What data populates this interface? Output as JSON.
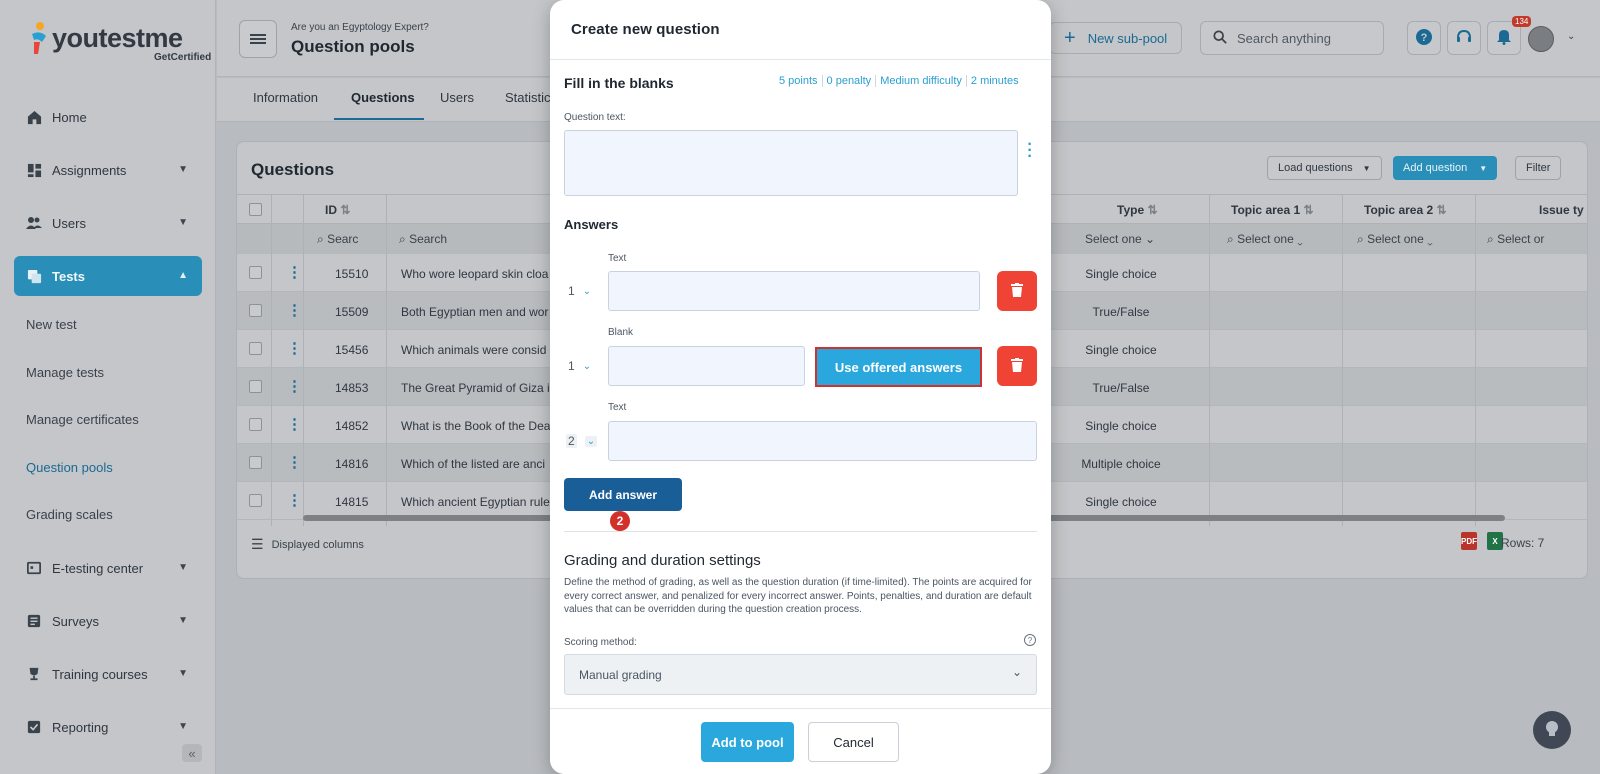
{
  "brand": {
    "name": "youtestme",
    "sub": "GetCertified"
  },
  "sidebar": {
    "items": [
      {
        "label": "Home"
      },
      {
        "label": "Assignments"
      },
      {
        "label": "Users"
      },
      {
        "label": "Tests"
      },
      {
        "label": "E-testing center"
      },
      {
        "label": "Surveys"
      },
      {
        "label": "Training courses"
      },
      {
        "label": "Reporting"
      }
    ],
    "sub_items": [
      {
        "label": "New test"
      },
      {
        "label": "Manage tests"
      },
      {
        "label": "Manage certificates"
      },
      {
        "label": "Question pools"
      },
      {
        "label": "Grading scales"
      }
    ]
  },
  "header": {
    "eyebrow": "Are you an Egyptology Expert?",
    "title": "Question pools",
    "new_sub_pool": "New sub-pool",
    "search_placeholder": "Search anything",
    "notifications": "134"
  },
  "tabs": [
    {
      "label": "Information"
    },
    {
      "label": "Questions"
    },
    {
      "label": "Users"
    },
    {
      "label": "Statistic"
    }
  ],
  "questions_card": {
    "title": "Questions",
    "load_questions": "Load questions",
    "add_question": "Add question",
    "filter": "Filter",
    "columns": {
      "id": "ID",
      "type": "Type",
      "topic1": "Topic area 1",
      "topic2": "Topic area 2",
      "issue": "Issue ty"
    },
    "filters": {
      "id": "Searc",
      "text": "Search",
      "type": "Select one",
      "topic1": "Select one",
      "topic2": "Select one",
      "issue": "Select or"
    },
    "rows": [
      {
        "id": "15510",
        "text": "Who wore leopard skin cloa",
        "type": "Single choice"
      },
      {
        "id": "15509",
        "text": "Both Egyptian men and wor",
        "type": "True/False"
      },
      {
        "id": "15456",
        "text": "Which animals were consid",
        "type": "Single choice"
      },
      {
        "id": "14853",
        "text": "The Great Pyramid of Giza i",
        "type": "True/False"
      },
      {
        "id": "14852",
        "text": "What is the Book of the Dea",
        "type": "Single choice"
      },
      {
        "id": "14816",
        "text": "Which of the listed are anci",
        "type": "Multiple choice"
      },
      {
        "id": "14815",
        "text": "Which ancient Egyptian rule",
        "type": "Single choice"
      }
    ],
    "displayed_columns": "Displayed columns",
    "rows_count": "Rows: 7"
  },
  "modal": {
    "title": "Create new question",
    "section_title": "Fill in the blanks",
    "meta": [
      "5 points",
      "0 penalty",
      "Medium difficulty",
      "2 minutes"
    ],
    "question_text_label": "Question text:",
    "answers_title": "Answers",
    "answers": [
      {
        "label": "Text",
        "order": "1"
      },
      {
        "label": "Blank",
        "order": "1"
      },
      {
        "label": "Text",
        "order": "2"
      }
    ],
    "use_offered_answers": "Use offered answers",
    "add_answer": "Add answer",
    "step_badge": "2",
    "grading_title": "Grading and duration settings",
    "grading_desc": "Define the method of grading, as well as the question duration (if time-limited). The points are acquired for every correct answer, and penalized for every incorrect answer. Points, penalties, and duration are default values that can be overridden during the question creation process.",
    "scoring_label": "Scoring method:",
    "scoring_value": "Manual grading",
    "add_to_pool": "Add to pool",
    "cancel": "Cancel"
  }
}
